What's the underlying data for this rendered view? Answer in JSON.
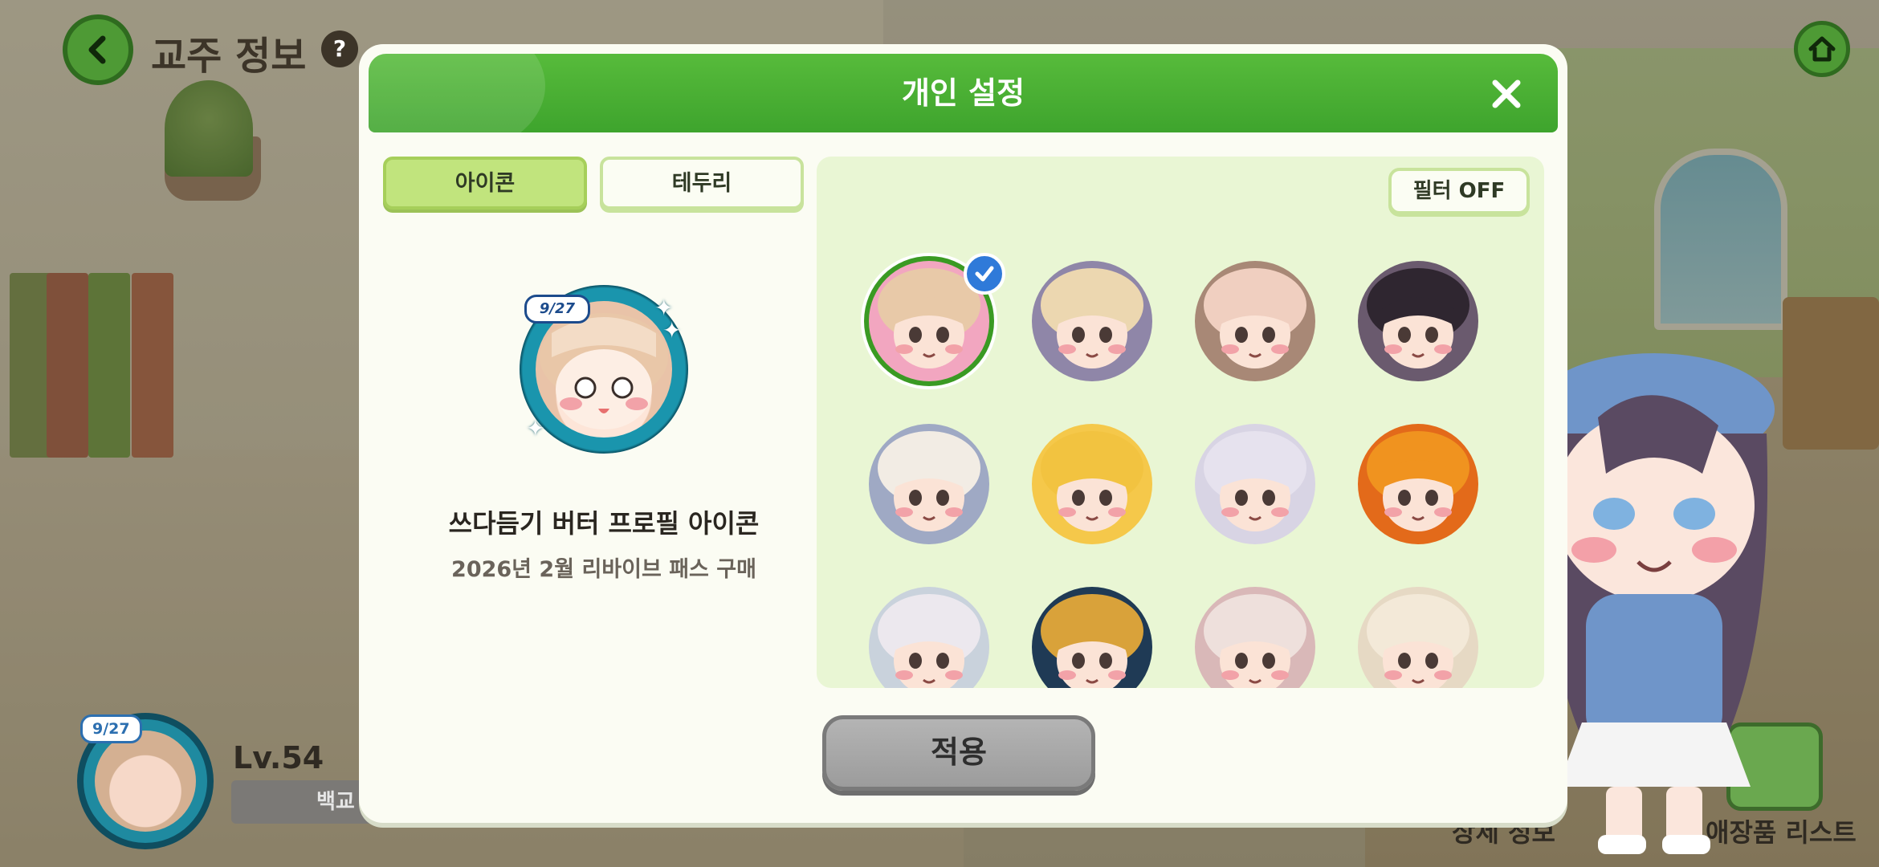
{
  "hud": {
    "page_title": "교주 정보",
    "help_icon_glyph": "?",
    "level": "Lv.54",
    "name_partial": "백교",
    "avatar_badge": "9/27",
    "detail_label": "상세 정보",
    "jewelry_label": "애장품 리스트"
  },
  "dialog": {
    "title": "개인 설정",
    "tabs": [
      {
        "label": "아이콘",
        "active": true
      },
      {
        "label": "테두리",
        "active": false
      }
    ],
    "preview": {
      "badge": "9/27",
      "name": "쓰다듬기 버터 프로필 아이콘",
      "description": "2026년 2월 리바이브 패스 구매"
    },
    "filter_label": "필터 OFF",
    "apply_label": "적용",
    "icons": [
      {
        "id": "butter-pat",
        "selected": true,
        "bg": "#f2a6c0",
        "hair": "#e8c9a8"
      },
      {
        "id": "blonde-maid",
        "selected": false,
        "bg": "#8f86a8",
        "hair": "#ecd7b0"
      },
      {
        "id": "cat-ear-girl",
        "selected": false,
        "bg": "#a88876",
        "hair": "#f0cfc0"
      },
      {
        "id": "horned-girl",
        "selected": false,
        "bg": "#6a5a6e",
        "hair": "#2f2630"
      },
      {
        "id": "sheep-girl",
        "selected": false,
        "bg": "#9fa9c4",
        "hair": "#f2ece4"
      },
      {
        "id": "yellow-girl",
        "selected": false,
        "bg": "#f5c84a",
        "hair": "#f2c340"
      },
      {
        "id": "tiara-girl",
        "selected": false,
        "bg": "#d8d4e4",
        "hair": "#e6e2ee"
      },
      {
        "id": "fire-spirit",
        "selected": false,
        "bg": "#e36a1a",
        "hair": "#f0931f"
      },
      {
        "id": "white-hair-girl",
        "selected": false,
        "bg": "#c9d2dc",
        "hair": "#ece8ee"
      },
      {
        "id": "robot",
        "selected": false,
        "bg": "#1f3a55",
        "hair": "#d9a23a"
      },
      {
        "id": "red-cap-girl",
        "selected": false,
        "bg": "#d9b8b8",
        "hair": "#eee0dc"
      },
      {
        "id": "cream-hair-girl",
        "selected": false,
        "bg": "#e6d9c4",
        "hair": "#f3e9d8"
      }
    ]
  },
  "colors": {
    "header_green": "#4bb233",
    "tab_active": "#c1e47d",
    "panel_bg": "#e9f6d4",
    "selected_ring": "#3a9a23",
    "check_blue": "#2f7ad9",
    "apply_disabled": "#a8a8a8"
  }
}
